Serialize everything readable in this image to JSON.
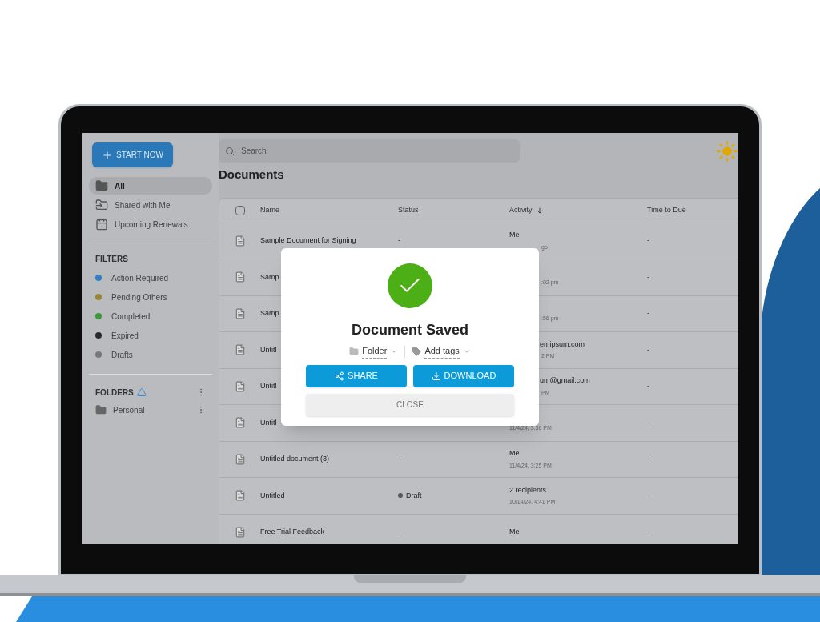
{
  "sidebar": {
    "start_button": "START NOW",
    "nav": [
      {
        "label": "All",
        "selected": true
      },
      {
        "label": "Shared with Me",
        "selected": false
      },
      {
        "label": "Upcoming Renewals",
        "selected": false
      }
    ],
    "filters_title": "FILTERS",
    "filters": [
      {
        "label": "Action Required",
        "color": "#2f80c8"
      },
      {
        "label": "Pending Others",
        "color": "#9c8530"
      },
      {
        "label": "Completed",
        "color": "#3a9a3a"
      },
      {
        "label": "Expired",
        "color": "#2a2a2a"
      },
      {
        "label": "Drafts",
        "color": "#777777"
      }
    ],
    "folders_title": "FOLDERS",
    "folders": [
      {
        "label": "Personal"
      }
    ]
  },
  "search": {
    "placeholder": "Search"
  },
  "title": "Documents",
  "table": {
    "select_all": {
      "checked": false
    },
    "columns": [
      "Name",
      "Status",
      "Activity",
      "Time to Due"
    ],
    "rows": [
      {
        "name": "Sample Document for Signing",
        "kind": "plain",
        "status": "-",
        "activity": "Me",
        "activity_sub": "go",
        "due": "-"
      },
      {
        "name": "Samp",
        "kind": "plain",
        "status": "",
        "activity": "",
        "activity_sub": ":02 pm",
        "due": "-"
      },
      {
        "name": "Samp",
        "kind": "plain",
        "status": "",
        "activity": "",
        "activity_sub": ":56 pm",
        "due": "-"
      },
      {
        "name": "Untitl",
        "kind": "plain",
        "status": "",
        "activity": "emipsum.com",
        "activity_sub": "2 PM",
        "due": "-"
      },
      {
        "name": "Untitl",
        "kind": "plain",
        "status": "",
        "activity": "um@gmail.com",
        "activity_sub": "PM",
        "due": "-"
      },
      {
        "name": "Untitl",
        "kind": "plain",
        "status": "",
        "activity": "",
        "activity_sub": "11/4/24, 3:36 PM",
        "due": "-"
      },
      {
        "name": "Untitled document (3)",
        "kind": "plain",
        "status": "-",
        "activity": "Me",
        "activity_sub": "11/4/24, 3:25 PM",
        "due": "-"
      },
      {
        "name": "Untitled",
        "kind": "draft",
        "status": "Draft",
        "activity": "2 recipients",
        "activity_sub": "10/14/24, 4:41 PM",
        "due": "-"
      },
      {
        "name": "Free Trial Feedback",
        "kind": "plain",
        "status": "-",
        "activity": "Me",
        "activity_sub": "",
        "due": "-"
      }
    ]
  },
  "dialog": {
    "title": "Document Saved",
    "folder": "Folder",
    "tags": "Add tags",
    "share": "SHARE",
    "download": "DOWNLOAD",
    "close": "CLOSE"
  }
}
